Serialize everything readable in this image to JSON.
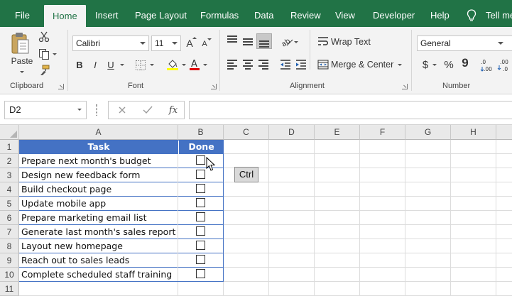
{
  "tabs": [
    {
      "label": "File",
      "active": false
    },
    {
      "label": "Home",
      "active": true
    },
    {
      "label": "Insert",
      "active": false
    },
    {
      "label": "Page Layout",
      "active": false
    },
    {
      "label": "Formulas",
      "active": false
    },
    {
      "label": "Data",
      "active": false
    },
    {
      "label": "Review",
      "active": false
    },
    {
      "label": "View",
      "active": false
    },
    {
      "label": "Developer",
      "active": false
    },
    {
      "label": "Help",
      "active": false
    }
  ],
  "tell_me": "Tell me",
  "ribbon": {
    "clipboard": {
      "label": "Clipboard",
      "paste": "Paste"
    },
    "font": {
      "label": "Font",
      "name": "Calibri",
      "size": "11",
      "bold": "B",
      "italic": "I",
      "underline": "U",
      "grow": "A",
      "shrink": "A"
    },
    "alignment": {
      "label": "Alignment",
      "wrap_text": "Wrap Text",
      "merge_center": "Merge & Center"
    },
    "number": {
      "label": "Number",
      "format": "General",
      "currency": "$",
      "percent": "%",
      "comma": "9"
    }
  },
  "formula_bar": {
    "name_box": "D2",
    "fx": "fx",
    "formula": ""
  },
  "columns": [
    "A",
    "B",
    "C",
    "D",
    "E",
    "F",
    "G",
    "H"
  ],
  "rows": [
    "1",
    "2",
    "3",
    "4",
    "5",
    "6",
    "7",
    "8",
    "9",
    "10",
    "11"
  ],
  "table": {
    "headers": [
      "Task",
      "Done"
    ],
    "tasks": [
      "Prepare next month's budget",
      "Design new feedback form",
      "Build checkout page",
      "Update mobile app",
      "Prepare marketing email list",
      "Generate last month's sales report",
      "Layout new homepage",
      "Reach out to sales leads",
      "Complete scheduled staff training"
    ]
  },
  "tooltip": "Ctrl",
  "colors": {
    "accent": "#217346",
    "table_header": "#4472c4"
  }
}
